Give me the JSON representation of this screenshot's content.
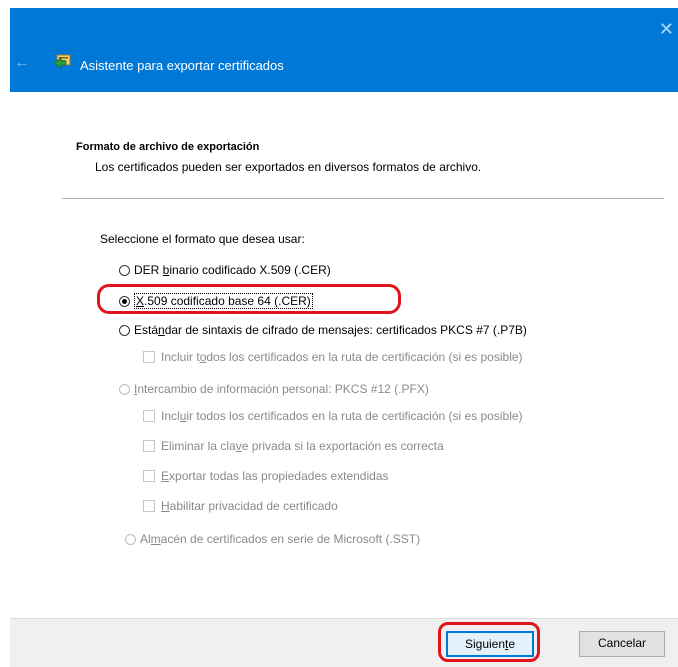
{
  "window": {
    "title": "Asistente para exportar certificados",
    "back_icon": "←",
    "close_icon": "✕",
    "accent_color": "#0078d7"
  },
  "header": {
    "title": "Formato de archivo de exportación",
    "subtitle": "Los certificados pueden ser exportados en diversos formatos de archivo."
  },
  "form": {
    "prompt": "Seleccione el formato que desea usar:",
    "opt_der": {
      "pre": "DER ",
      "acc": "b",
      "post": "inario codificado X.509 (.CER)",
      "selected": false
    },
    "opt_b64": {
      "pre": "",
      "acc": "X",
      "post": ".509 codificado base 64 (.CER)",
      "selected": true
    },
    "opt_pkcs7": {
      "pre": "Está",
      "acc": "n",
      "post": "dar de sintaxis de cifrado de mensajes: certificados PKCS #7 (.P7B)",
      "selected": false
    },
    "pkcs7_include": {
      "pre": "Incluir t",
      "acc": "o",
      "post": "dos los certificados en la ruta de certificación (si es posible)"
    },
    "opt_pfx": {
      "pre": "",
      "acc": "I",
      "post": "ntercambio de información personal: PKCS #12 (.PFX)",
      "selected": false
    },
    "pfx_include": {
      "pre": "Incl",
      "acc": "u",
      "post": "ir todos los certificados en la ruta de certificación (si es posible)"
    },
    "pfx_delete": {
      "pre": "Eliminar la cla",
      "acc": "v",
      "post": "e privada si la exportación es correcta"
    },
    "pfx_export": {
      "pre": "",
      "acc": "E",
      "post": "xportar todas las propiedades extendidas"
    },
    "pfx_privacy": {
      "pre": "",
      "acc": "H",
      "post": "abilitar privacidad de certificado"
    },
    "opt_sst": {
      "pre": "Al",
      "acc": "m",
      "post": "acén de certificados en serie de Microsoft (.SST)",
      "selected": false
    }
  },
  "buttons": {
    "next": {
      "pre": "Siguien",
      "acc": "t",
      "post": "e"
    },
    "cancel": "Cancelar"
  },
  "annotation_color": "#e2141b"
}
